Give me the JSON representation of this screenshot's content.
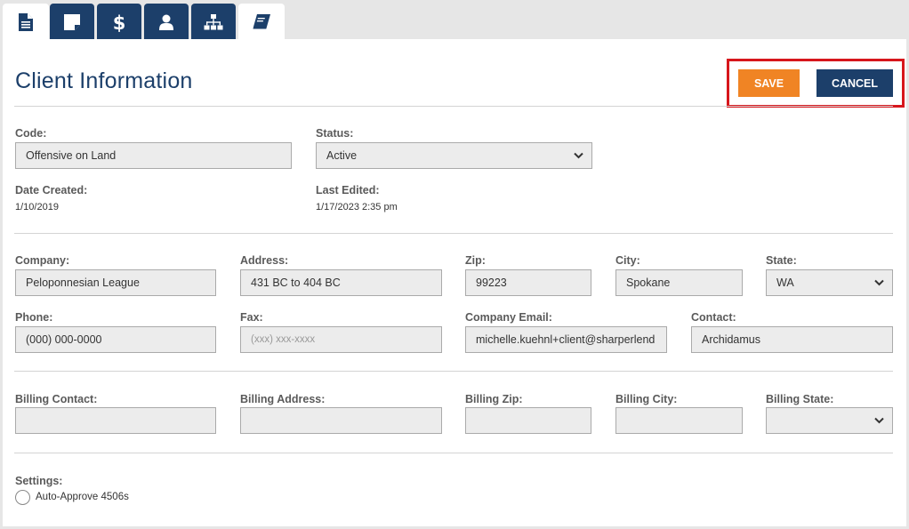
{
  "tabs": [
    {
      "icon": "document-icon",
      "active": true
    },
    {
      "icon": "note-icon",
      "active": false
    },
    {
      "icon": "dollar-icon",
      "active": false
    },
    {
      "icon": "user-icon",
      "active": false
    },
    {
      "icon": "org-chart-icon",
      "active": false
    },
    {
      "icon": "book-icon",
      "active": false
    }
  ],
  "header": {
    "title": "Client Information",
    "save_label": "SAVE",
    "cancel_label": "CANCEL"
  },
  "general": {
    "code_label": "Code:",
    "code_value": "Offensive on Land",
    "status_label": "Status:",
    "status_value": "Active",
    "date_created_label": "Date Created:",
    "date_created_value": "1/10/2019",
    "last_edited_label": "Last Edited:",
    "last_edited_value": "1/17/2023 2:35 pm"
  },
  "contact": {
    "company_label": "Company:",
    "company_value": "Peloponnesian League",
    "address_label": "Address:",
    "address_value": "431 BC to 404 BC",
    "zip_label": "Zip:",
    "zip_value": "99223",
    "city_label": "City:",
    "city_value": "Spokane",
    "state_label": "State:",
    "state_value": "WA",
    "phone_label": "Phone:",
    "phone_value": "(000) 000-0000",
    "fax_label": "Fax:",
    "fax_placeholder": "(xxx) xxx-xxxx",
    "email_label": "Company Email:",
    "email_value": "michelle.kuehnl+client@sharperlend",
    "contact_label": "Contact:",
    "contact_value": "Archidamus"
  },
  "billing": {
    "contact_label": "Billing Contact:",
    "address_label": "Billing Address:",
    "zip_label": "Billing Zip:",
    "city_label": "Billing City:",
    "state_label": "Billing State:"
  },
  "settings": {
    "label": "Settings:",
    "auto_approve_label": "Auto-Approve 4506s"
  },
  "colors": {
    "navy": "#1c3f6a",
    "orange": "#f08424",
    "highlight_red": "#d7161c"
  }
}
